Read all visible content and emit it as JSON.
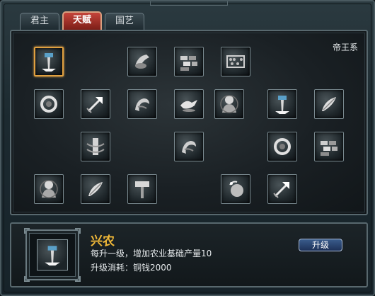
{
  "tabs": [
    {
      "label": "君主",
      "active": false
    },
    {
      "label": "天赋",
      "active": true
    },
    {
      "label": "国艺",
      "active": false
    }
  ],
  "panel": {
    "faction_label": "帝王系",
    "skills": [
      {
        "id": "s1",
        "icon": "hoe-icon",
        "selected": true
      },
      {
        "id": "s2",
        "icon": "hand-scroll-icon"
      },
      {
        "id": "s3",
        "icon": "bricks-icon"
      },
      {
        "id": "s4",
        "icon": "abacus-icon"
      },
      {
        "id": "s5",
        "icon": "ring-icon"
      },
      {
        "id": "s6",
        "icon": "arrow-icon"
      },
      {
        "id": "s7",
        "icon": "dragon-icon"
      },
      {
        "id": "s8",
        "icon": "dove-icon"
      },
      {
        "id": "s9",
        "icon": "monk-icon"
      },
      {
        "id": "s10",
        "icon": "hoe-icon"
      },
      {
        "id": "s11",
        "icon": "feather-icon"
      },
      {
        "id": "s12",
        "icon": "pillar-icon"
      },
      {
        "id": "s13",
        "icon": "dragon-icon"
      },
      {
        "id": "s14",
        "icon": "ring-icon"
      },
      {
        "id": "s15",
        "icon": "bricks-icon"
      },
      {
        "id": "s16",
        "icon": "monk-icon"
      },
      {
        "id": "s17",
        "icon": "feather-icon"
      },
      {
        "id": "s18",
        "icon": "hammer-icon"
      },
      {
        "id": "s19",
        "icon": "globe-icon"
      },
      {
        "id": "s20",
        "icon": "arrow-icon"
      }
    ]
  },
  "info": {
    "icon": "hoe-icon",
    "skill_name": "兴农",
    "description": "每升一级，增加农业基础产量10",
    "cost": "升级消耗：铜钱2000",
    "upgrade_label": "升级"
  },
  "colors": {
    "accent_gold": "#f0b838",
    "active_tab": "#c4443a",
    "button_blue": "#2c4a78"
  }
}
